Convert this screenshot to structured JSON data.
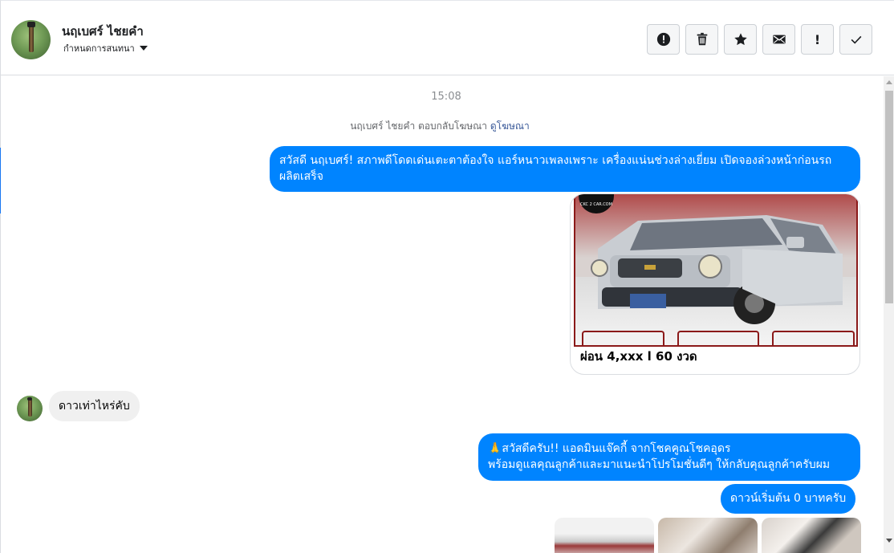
{
  "header": {
    "contact_name": "นฤเบศร์ ไชยคำ",
    "conversation_menu_label": "กำหนดการสนทนา",
    "toolbar": [
      {
        "icon": "alert-circle-icon",
        "glyph": "!"
      },
      {
        "icon": "trash-icon",
        "glyph": ""
      },
      {
        "icon": "star-icon",
        "glyph": "★"
      },
      {
        "icon": "envelope-icon",
        "glyph": ""
      },
      {
        "icon": "exclamation-icon",
        "glyph": "!"
      },
      {
        "icon": "check-icon",
        "glyph": "✓"
      }
    ]
  },
  "chat": {
    "timestamp": "15:08",
    "reply_note": {
      "text": "นฤเบศร์ ไชยคำ ตอบกลับโฆษณา",
      "link": "ดูโฆษณา"
    },
    "messages": [
      {
        "direction": "out",
        "text": "สวัสดี นฤเบศร์! สภาพดีโดดเด่นเตะตาต้องใจ แอร์หนาวเพลงเพราะ เครื่องแน่นช่วงล่างเยี่ยม เปิดจองล่วงหน้าก่อนรถผลิตเสร็จ"
      },
      {
        "direction": "out",
        "type": "ad-card",
        "watermark": "CKC 2 CAR.COM",
        "caption": "ผ่อน 4,xxx l 60 งวด"
      },
      {
        "direction": "in",
        "text": "ดาวเท่าไหร่คับ"
      },
      {
        "direction": "out",
        "line1": "🙏สวัสดีครับ!! แอดมินแจ๊คกี้ จากโชคคูณโชคอุดร",
        "line2": "พร้อมดูแลคุณลูกค้าและมาแนะนำโปรโมชั่นดีๆ ให้กลับคุณลูกค้าครับผม"
      },
      {
        "direction": "out",
        "text": "ดาวน์เริ่มต้น 0 บาทครับ"
      }
    ]
  },
  "colors": {
    "accent": "#0084ff",
    "incoming_bubble": "#f0f0f0",
    "link": "#385898"
  }
}
